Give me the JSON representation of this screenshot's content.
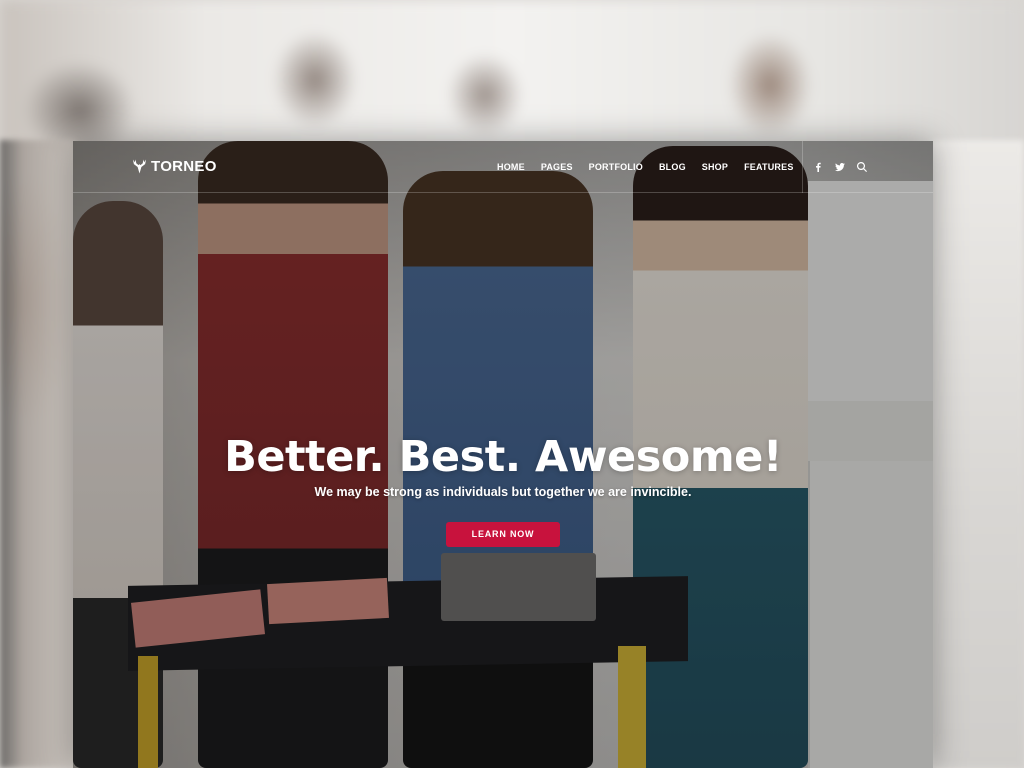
{
  "brand": {
    "name": "TORNEO",
    "logo_icon": "antlers-icon"
  },
  "nav": {
    "items": [
      {
        "label": "HOME"
      },
      {
        "label": "PAGES"
      },
      {
        "label": "PORTFOLIO"
      },
      {
        "label": "BLOG"
      },
      {
        "label": "SHOP"
      },
      {
        "label": "FEATURES"
      }
    ],
    "social": [
      {
        "icon": "facebook-icon"
      },
      {
        "icon": "twitter-icon"
      },
      {
        "icon": "search-icon"
      }
    ]
  },
  "hero": {
    "title": "Better. Best. Awesome!",
    "subtitle": "We may be strong as individuals but together we are invincible.",
    "cta_label": "LEARN NOW"
  },
  "colors": {
    "accent": "#c8123d",
    "text": "#ffffff"
  }
}
